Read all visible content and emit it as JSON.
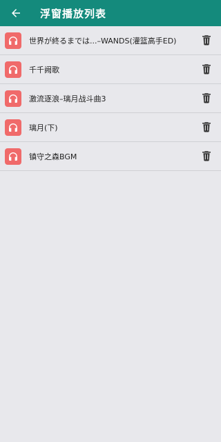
{
  "header": {
    "title": "浮窗播放列表",
    "back_icon": "arrow-left-icon",
    "background_color": "#148a7c"
  },
  "playlist": {
    "item_icon": "headphones-icon",
    "delete_icon": "trash-icon",
    "accent_color": "#f06a6a",
    "items": [
      {
        "title": "世界が終るまでは...–WANDS(灌篮高手ED)"
      },
      {
        "title": "千千阙歌"
      },
      {
        "title": "激流逐浪–璃月战斗曲3"
      },
      {
        "title": "璃月(下)"
      },
      {
        "title": "镇守之森BGM"
      }
    ]
  }
}
